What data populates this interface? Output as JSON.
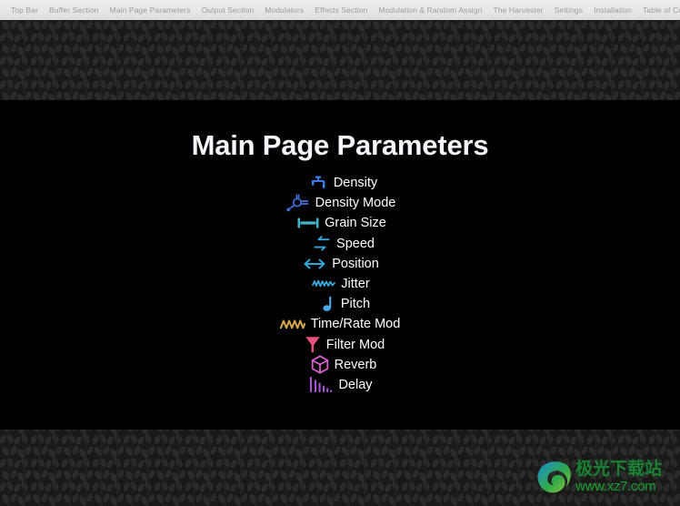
{
  "nav": {
    "items": [
      {
        "label": "Top Bar"
      },
      {
        "label": "Buffer Section"
      },
      {
        "label": "Main Page Parameters"
      },
      {
        "label": "Output Section"
      },
      {
        "label": "Modulators"
      },
      {
        "label": "Effects Section"
      },
      {
        "label": "Modulation & Random Assign"
      },
      {
        "label": "The Harvester"
      },
      {
        "label": "Settings"
      },
      {
        "label": "Installation"
      },
      {
        "label": "Table of Content"
      }
    ]
  },
  "main": {
    "title": "Main Page Parameters",
    "parameters": [
      {
        "label": "Density",
        "icon": "faucet-icon",
        "color": "#3b82f6"
      },
      {
        "label": "Density Mode",
        "icon": "spray-nozzle-icon",
        "color": "#3f6fd8"
      },
      {
        "label": "Grain Size",
        "icon": "width-measure-icon",
        "color": "#3fb6c8"
      },
      {
        "label": "Speed",
        "icon": "swap-arrows-icon",
        "color": "#37a7dd"
      },
      {
        "label": "Position",
        "icon": "left-right-arrow-icon",
        "color": "#2ea8d8"
      },
      {
        "label": "Jitter",
        "icon": "wave-squiggle-icon",
        "color": "#3aa9e0"
      },
      {
        "label": "Pitch",
        "icon": "music-note-icon",
        "color": "#4aa8e8"
      },
      {
        "label": "Time/Rate Mod",
        "icon": "zigzag-wave-icon",
        "color": "#d6a84a"
      },
      {
        "label": "Filter Mod",
        "icon": "funnel-icon",
        "color": "#e8527a"
      },
      {
        "label": "Reverb",
        "icon": "cube-icon",
        "color": "#d95fd0"
      },
      {
        "label": "Delay",
        "icon": "decay-bars-icon",
        "color": "#b052d8"
      }
    ]
  },
  "watermark": {
    "cn_text": "极光下载站",
    "url_text": "www.xz7.com"
  }
}
